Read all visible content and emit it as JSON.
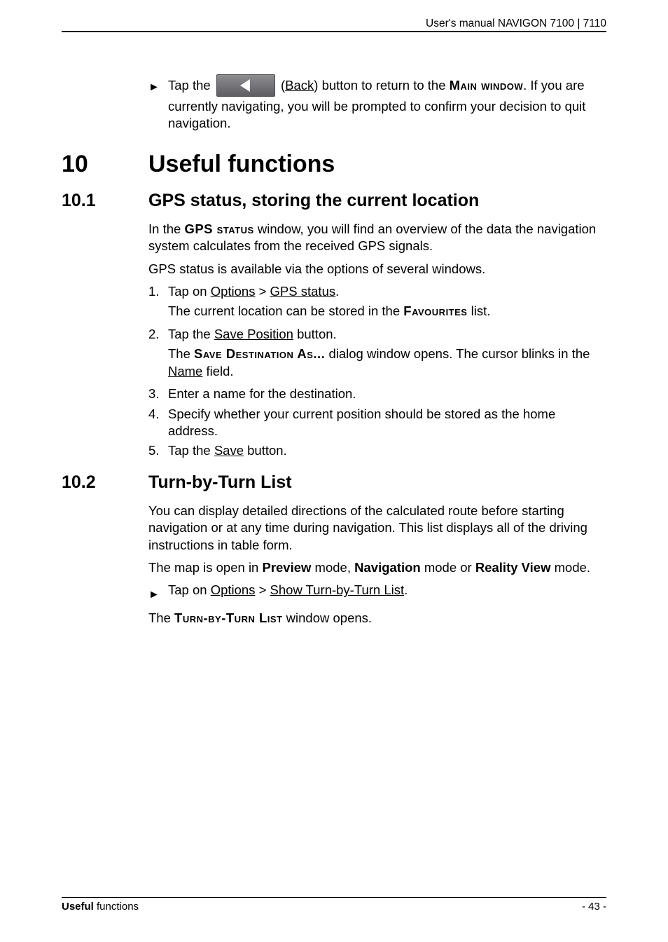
{
  "header": {
    "text": "User's manual NAVIGON 7100 | 7110"
  },
  "intro_bullet": {
    "pre": "Tap the ",
    "post1": " (",
    "back_link": "Back",
    "post2": ") button to return to the ",
    "main_window": "Main window",
    "post3": ". If you are currently navigating, you will be prompted to confirm your decision to quit navigation."
  },
  "h1": {
    "num": "10",
    "title": "Useful functions"
  },
  "sec1": {
    "num": "10.1",
    "title": "GPS status, storing the current location",
    "p1_a": "In the ",
    "p1_b": "GPS status",
    "p1_c": " window, you will find an overview of the data the navigation system calculates from the received GPS signals.",
    "p2": "GPS status is available via the options of several windows.",
    "step1_a": "Tap on ",
    "step1_opts": "Options",
    "step1_sep": " > ",
    "step1_gps": "GPS status",
    "step1_end": ".",
    "step1_sub_a": "The current location can be stored in the ",
    "step1_sub_b": "Favourites",
    "step1_sub_c": " list.",
    "step2_a": "Tap the ",
    "step2_link": "Save Position",
    "step2_b": " button.",
    "step2_sub_a": "The ",
    "step2_sub_b": "Save Destination As...",
    "step2_sub_c": " dialog window opens. The cursor blinks in the ",
    "step2_sub_name": "Name",
    "step2_sub_d": " field.",
    "step3": "Enter a name for the destination.",
    "step4": "Specify whether your current position should be stored as the home address.",
    "step5_a": "Tap the ",
    "step5_link": "Save",
    "step5_b": " button."
  },
  "sec2": {
    "num": "10.2",
    "title": "Turn-by-Turn List",
    "p1": "You can display detailed directions of the calculated route before starting navigation or at any time during navigation. This list displays all of the driving instructions in table form.",
    "p2_a": "The map is open in ",
    "p2_preview": "Preview",
    "p2_b": " mode, ",
    "p2_nav": "Navigation",
    "p2_c": " mode or ",
    "p2_rv": "Reality View",
    "p2_d": " mode.",
    "b_a": "Tap on ",
    "b_opts": "Options",
    "b_sep": " > ",
    "b_link": "Show Turn-by-Turn List",
    "b_end": ".",
    "p3_a": "The ",
    "p3_b": "Turn-by-Turn List",
    "p3_c": " window opens."
  },
  "footer": {
    "left_bold": "Useful",
    "left_rest": " functions",
    "right": "- 43 -"
  },
  "nums": {
    "n1": "1.",
    "n2": "2.",
    "n3": "3.",
    "n4": "4.",
    "n5": "5."
  },
  "bullet_glyph": "►"
}
